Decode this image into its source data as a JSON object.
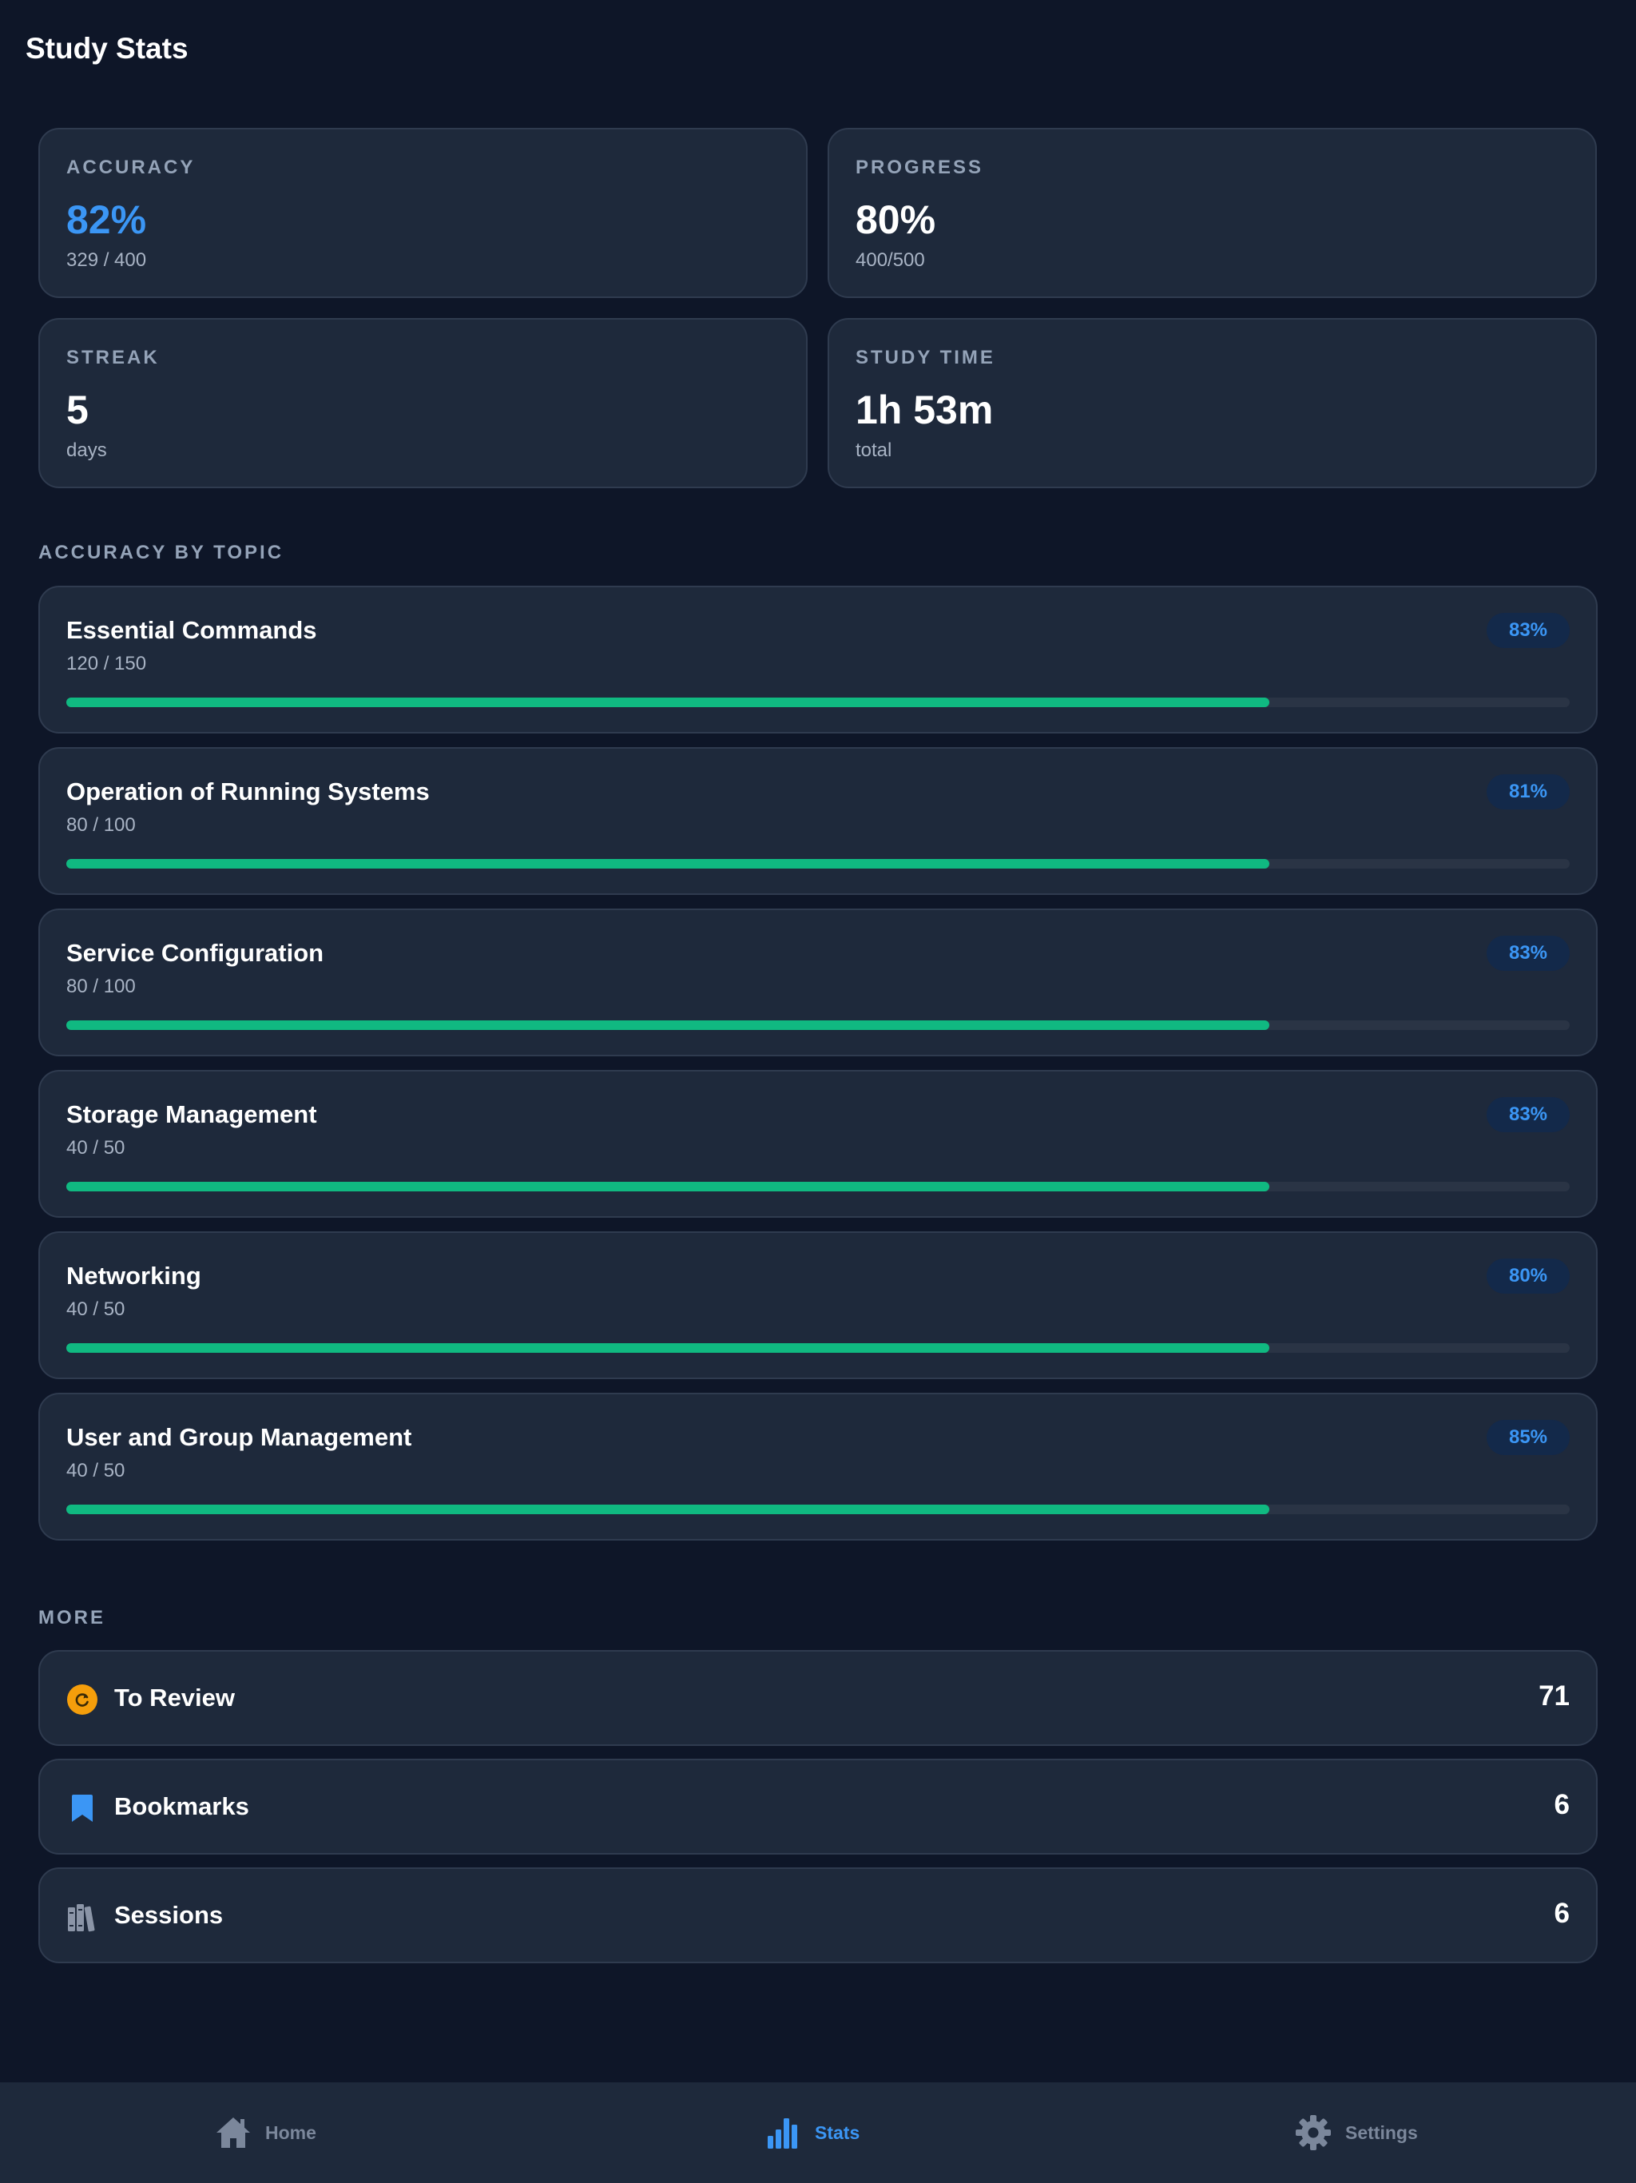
{
  "header": {
    "title": "Study Stats"
  },
  "stats": {
    "accuracy": {
      "label": "ACCURACY",
      "value": "82%",
      "sub": "329 / 400"
    },
    "progress": {
      "label": "PROGRESS",
      "value": "80%",
      "sub": "400/500"
    },
    "streak": {
      "label": "STREAK",
      "value": "5",
      "sub": "days"
    },
    "study_time": {
      "label": "STUDY TIME",
      "value": "1h 53m",
      "sub": "total"
    }
  },
  "topics_section": {
    "label": "ACCURACY BY TOPIC"
  },
  "topics": [
    {
      "name": "Essential Commands",
      "count": "120 / 150",
      "badge": "83%",
      "progress": 0.8
    },
    {
      "name": "Operation of Running Systems",
      "count": "80 / 100",
      "badge": "81%",
      "progress": 0.8
    },
    {
      "name": "Service Configuration",
      "count": "80 / 100",
      "badge": "83%",
      "progress": 0.8
    },
    {
      "name": "Storage Management",
      "count": "40 / 50",
      "badge": "83%",
      "progress": 0.8
    },
    {
      "name": "Networking",
      "count": "40 / 50",
      "badge": "80%",
      "progress": 0.8
    },
    {
      "name": "User and Group Management",
      "count": "40 / 50",
      "badge": "85%",
      "progress": 0.8
    }
  ],
  "more_section": {
    "label": "MORE"
  },
  "more": {
    "review": {
      "label": "To Review",
      "count": "71",
      "icon": "review-refresh-icon",
      "color": "#f59e0b"
    },
    "bookmarks": {
      "label": "Bookmarks",
      "count": "6",
      "icon": "bookmark-icon",
      "color": "#3b96f5"
    },
    "sessions": {
      "label": "Sessions",
      "count": "6",
      "icon": "books-icon",
      "color": "#8b95a7"
    }
  },
  "nav": {
    "home": {
      "label": "Home",
      "icon": "home-icon"
    },
    "stats": {
      "label": "Stats",
      "icon": "bar-chart-icon",
      "active": true
    },
    "settings": {
      "label": "Settings",
      "icon": "gear-icon"
    }
  },
  "colors": {
    "background": "#0e1628",
    "card": "#1e293b",
    "accent": "#3b96f5",
    "progress_fill": "#10b981"
  }
}
